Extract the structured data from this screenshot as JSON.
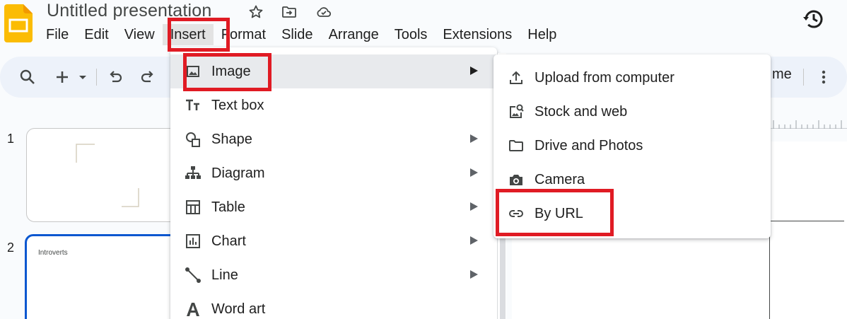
{
  "app": {
    "title": "Untitled presentation",
    "accent_color": "#fbbc04",
    "selection_color": "#0b57d0",
    "annotation_color": "#e01b24"
  },
  "title_icons": [
    "star-icon",
    "move-to-folder-icon",
    "cloud-saved-icon"
  ],
  "menubar": {
    "items": [
      "File",
      "Edit",
      "View",
      "Insert",
      "Format",
      "Slide",
      "Arrange",
      "Tools",
      "Extensions",
      "Help"
    ],
    "active": "Insert"
  },
  "toolbar": {
    "icons": [
      "search-icon",
      "new-slide-icon",
      "dropdown-arrow-icon",
      "undo-icon",
      "redo-icon",
      "more-vert-icon"
    ],
    "partial_label": "me"
  },
  "filmstrip": {
    "slides": [
      {
        "number": "1",
        "text": ""
      },
      {
        "number": "2",
        "text": "Introverts"
      }
    ]
  },
  "insert_menu": {
    "items": [
      {
        "label": "Image",
        "icon": "image-icon",
        "submenu": true
      },
      {
        "label": "Text box",
        "icon": "text-box-icon",
        "submenu": false
      },
      {
        "label": "Shape",
        "icon": "shape-icon",
        "submenu": true
      },
      {
        "label": "Diagram",
        "icon": "diagram-icon",
        "submenu": true
      },
      {
        "label": "Table",
        "icon": "table-icon",
        "submenu": true
      },
      {
        "label": "Chart",
        "icon": "chart-icon",
        "submenu": true
      },
      {
        "label": "Line",
        "icon": "line-icon",
        "submenu": true
      },
      {
        "label": "Word art",
        "icon": "word-art-icon",
        "submenu": false
      }
    ]
  },
  "image_submenu": {
    "items": [
      {
        "label": "Upload from computer",
        "icon": "upload-icon"
      },
      {
        "label": "Stock and web",
        "icon": "image-search-icon"
      },
      {
        "label": "Drive and Photos",
        "icon": "folder-icon"
      },
      {
        "label": "Camera",
        "icon": "camera-icon"
      },
      {
        "label": "By URL",
        "icon": "link-icon"
      }
    ]
  }
}
